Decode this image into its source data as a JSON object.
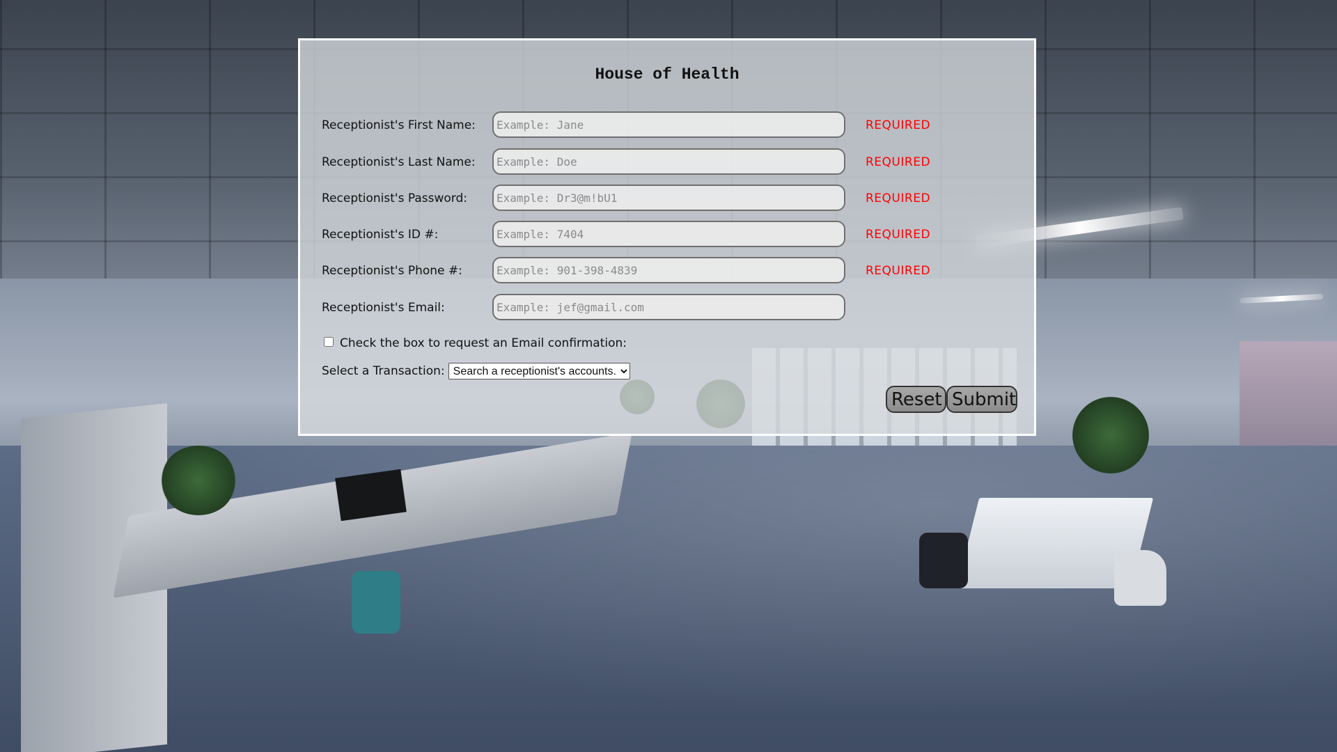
{
  "form": {
    "title": "House of Health",
    "fields": [
      {
        "label": "Receptionist's First Name:",
        "placeholder": "Example: Jane",
        "value": "",
        "required": "REQUIRED"
      },
      {
        "label": "Receptionist's Last Name:",
        "placeholder": "Example: Doe",
        "value": "",
        "required": "REQUIRED"
      },
      {
        "label": "Receptionist's Password:",
        "placeholder": "Example: Dr3@m!bU1",
        "value": "",
        "required": "REQUIRED"
      },
      {
        "label": "Receptionist's ID #:",
        "placeholder": "Example: 7404",
        "value": "",
        "required": "REQUIRED"
      },
      {
        "label": "Receptionist's Phone #:",
        "placeholder": "Example: 901-398-4839",
        "value": "",
        "required": "REQUIRED"
      },
      {
        "label": "Receptionist's Email:",
        "placeholder": "Example: jef@gmail.com",
        "value": ""
      }
    ],
    "email_confirmation": {
      "label": "Check the box to request an Email confirmation:",
      "checked": false
    },
    "transaction": {
      "label": "Select a Transaction:",
      "selected": "Search a receptionist's accounts."
    },
    "buttons": {
      "reset": "Reset",
      "submit": "Submit"
    }
  },
  "colors": {
    "required": "#ff0000",
    "panel_border": "#ffffff",
    "button_bg": "#999999"
  }
}
